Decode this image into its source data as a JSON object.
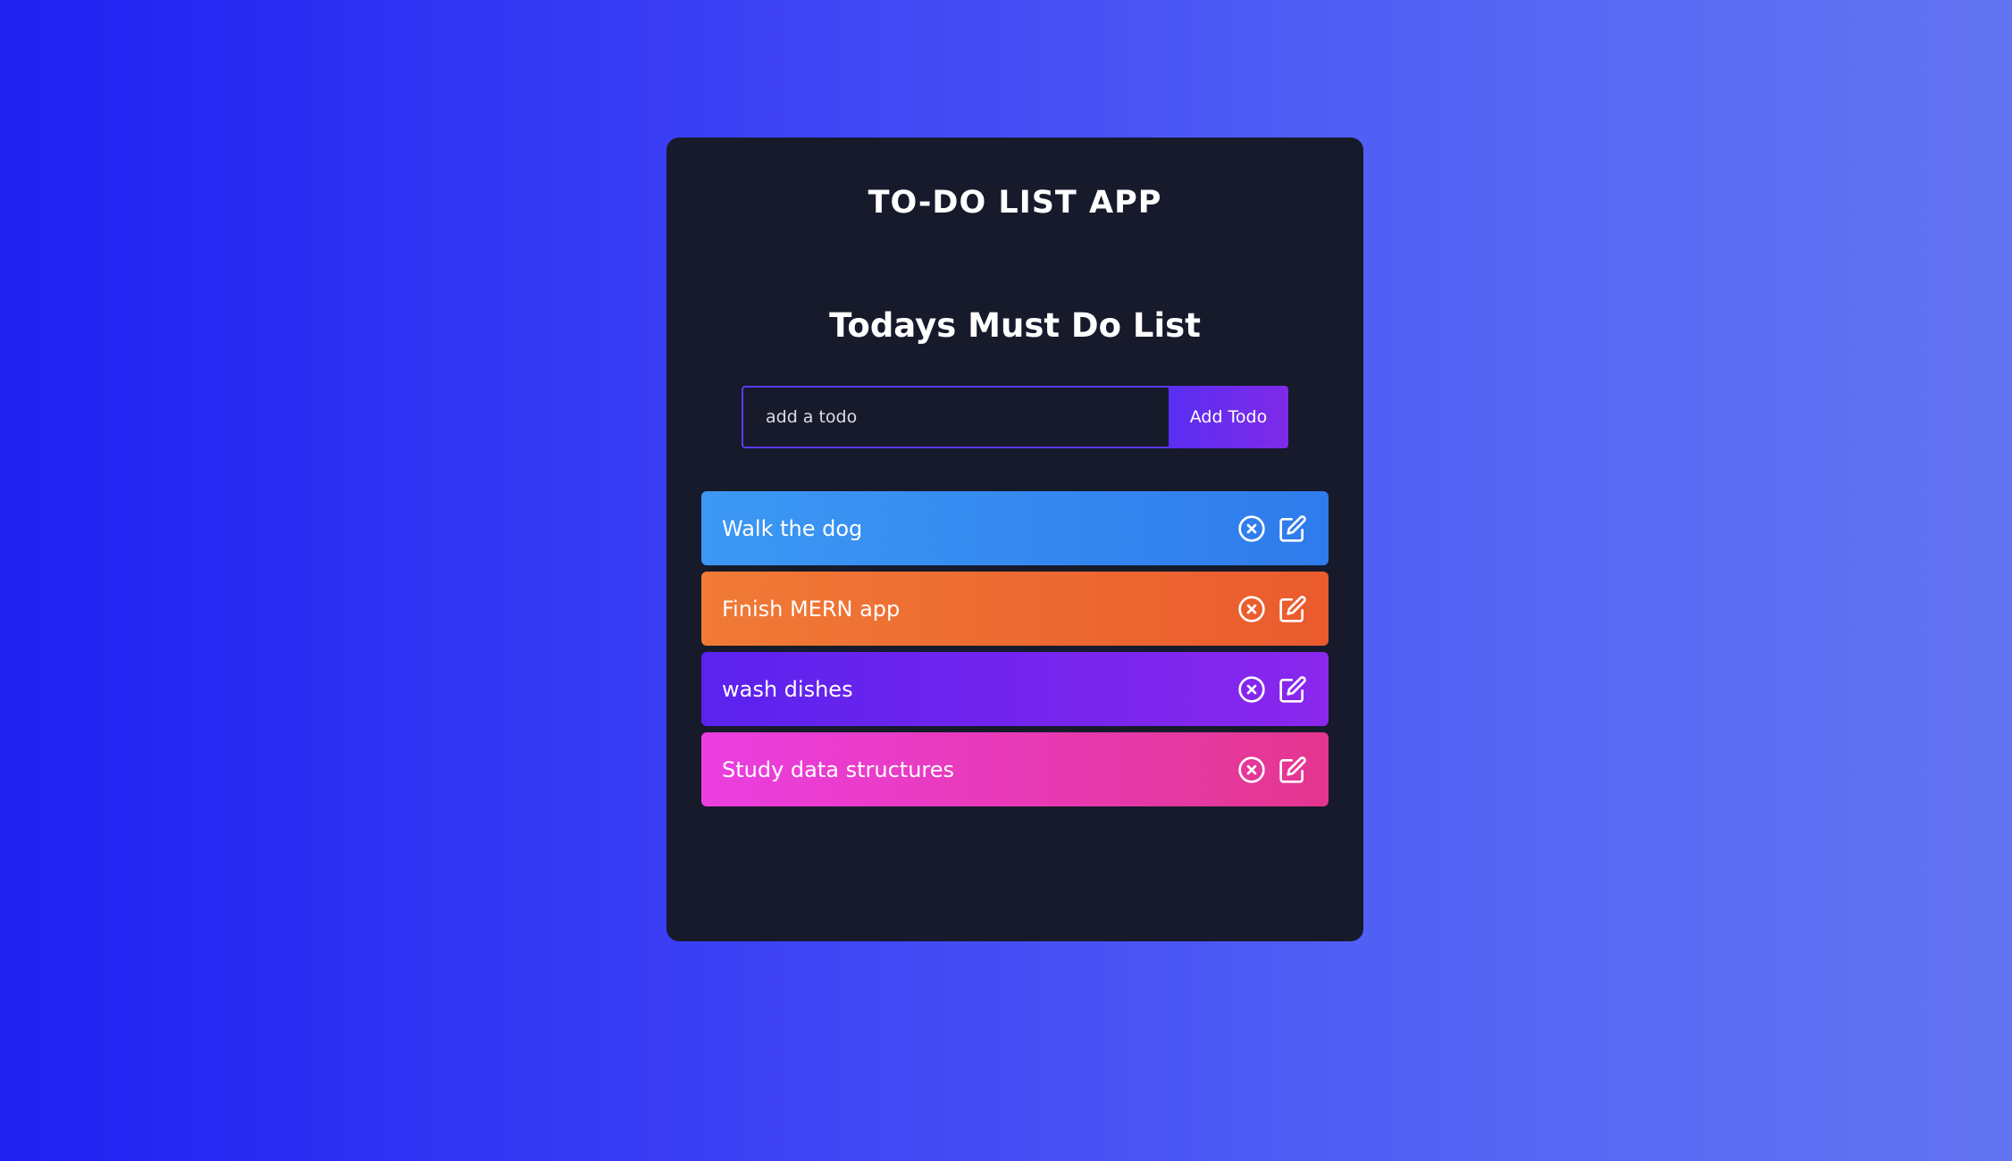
{
  "app": {
    "title": "TO-DO LIST APP"
  },
  "list": {
    "heading": "Todays Must Do List"
  },
  "form": {
    "input_placeholder": "add a todo",
    "input_value": "",
    "add_button_label": "Add Todo"
  },
  "todos": [
    {
      "text": "Walk the dog",
      "color_from": "#3c98f4",
      "color_to": "#2f7bec"
    },
    {
      "text": "Finish MERN app",
      "color_from": "#f07a36",
      "color_to": "#ea5b2e"
    },
    {
      "text": "wash dishes",
      "color_from": "#5b22ee",
      "color_to": "#8a27ed"
    },
    {
      "text": "Study data structures",
      "color_from": "#eb3ee0",
      "color_to": "#e4368e"
    }
  ],
  "icons": {
    "delete": "close-circle-icon",
    "edit": "edit-icon"
  },
  "colors": {
    "card_background": "#161a2b",
    "accent": "#5d3af0"
  }
}
